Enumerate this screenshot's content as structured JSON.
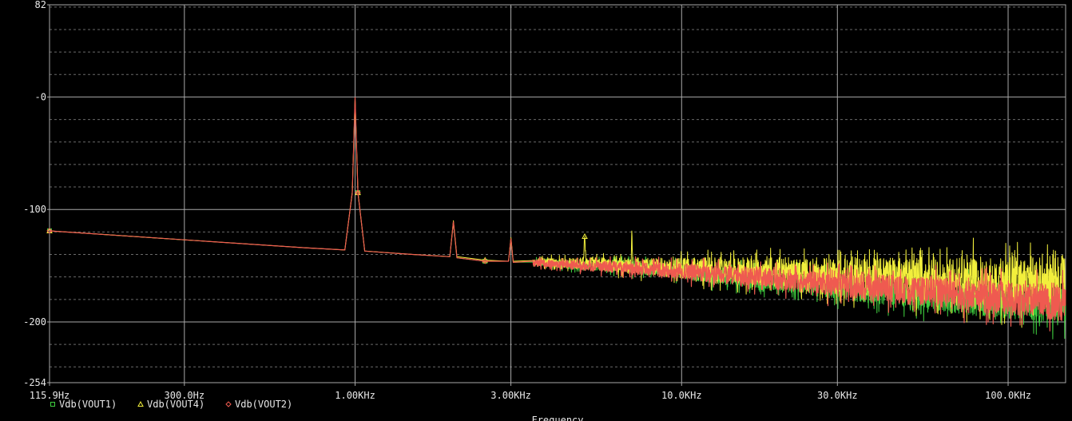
{
  "chart_data": {
    "type": "line",
    "xscale": "log",
    "xlim": [
      115.9,
      150000
    ],
    "ylim": [
      -254,
      82
    ],
    "xlabel": "Frequency",
    "ylabel": "",
    "grid": true,
    "legend_placement": "bottom-left",
    "colors": {
      "background": "#000000",
      "grid_major": "#a8a8a8",
      "grid_minor": "#6a6a6a",
      "text": "#e8e8e8"
    },
    "x_ticks": [
      {
        "value": 115.9,
        "label": "115.9Hz"
      },
      {
        "value": 300,
        "label": "300.0Hz"
      },
      {
        "value": 1000,
        "label": "1.00KHz"
      },
      {
        "value": 3000,
        "label": "3.00KHz"
      },
      {
        "value": 10000,
        "label": "10.0KHz"
      },
      {
        "value": 30000,
        "label": "30.0KHz"
      },
      {
        "value": 100000,
        "label": "100.0KHz"
      }
    ],
    "y_ticks": [
      {
        "value": 82,
        "label": "82"
      },
      {
        "value": 0,
        "label": "-0"
      },
      {
        "value": -100,
        "label": "-100"
      },
      {
        "value": -200,
        "label": "-200"
      },
      {
        "value": -254,
        "label": "-254"
      }
    ],
    "series": [
      {
        "name": "Vdb(VOUT1)",
        "color": "#3fcf3f",
        "marker": "square",
        "points": [
          [
            115.9,
            -119
          ],
          [
            300,
            -127
          ],
          [
            700,
            -134
          ],
          [
            930,
            -136
          ],
          [
            980,
            -85
          ],
          [
            1000,
            -1
          ],
          [
            1020,
            -85
          ],
          [
            1070,
            -137
          ],
          [
            1500,
            -140
          ],
          [
            1950,
            -142
          ],
          [
            2000,
            -112
          ],
          [
            2050,
            -143
          ],
          [
            2500,
            -146
          ],
          [
            2950,
            -146
          ],
          [
            3000,
            -128
          ],
          [
            3050,
            -147
          ],
          [
            4000,
            -148
          ],
          [
            5000,
            -150
          ],
          [
            6000,
            -150
          ],
          [
            7000,
            -151
          ],
          [
            8000,
            -153
          ],
          [
            10000,
            -155
          ],
          [
            12000,
            -158
          ],
          [
            15000,
            -160
          ],
          [
            20000,
            -164
          ],
          [
            25000,
            -166
          ],
          [
            30000,
            -169
          ],
          [
            40000,
            -172
          ],
          [
            50000,
            -175
          ],
          [
            60000,
            -177
          ],
          [
            80000,
            -180
          ],
          [
            100000,
            -182
          ],
          [
            120000,
            -183
          ],
          [
            150000,
            -187
          ]
        ]
      },
      {
        "name": "Vdb(VOUT4)",
        "color": "#f2ef3c",
        "marker": "triangle",
        "points": [
          [
            115.9,
            -119
          ],
          [
            300,
            -127
          ],
          [
            700,
            -134
          ],
          [
            930,
            -136
          ],
          [
            980,
            -85
          ],
          [
            1000,
            -2
          ],
          [
            1020,
            -85
          ],
          [
            1070,
            -137
          ],
          [
            1500,
            -140
          ],
          [
            1950,
            -142
          ],
          [
            2000,
            -110
          ],
          [
            2050,
            -142
          ],
          [
            2500,
            -145
          ],
          [
            2950,
            -146
          ],
          [
            3000,
            -125
          ],
          [
            3050,
            -146
          ],
          [
            4000,
            -147
          ],
          [
            5000,
            -148
          ],
          [
            5050,
            -124
          ],
          [
            5100,
            -148
          ],
          [
            6000,
            -149
          ],
          [
            7000,
            -150
          ],
          [
            7050,
            -120
          ],
          [
            7100,
            -150
          ],
          [
            8000,
            -151
          ],
          [
            10000,
            -152
          ],
          [
            12000,
            -153
          ],
          [
            15000,
            -154
          ],
          [
            20000,
            -156
          ],
          [
            25000,
            -157
          ],
          [
            30000,
            -158
          ],
          [
            40000,
            -160
          ],
          [
            50000,
            -161
          ],
          [
            60000,
            -162
          ],
          [
            80000,
            -163
          ],
          [
            100000,
            -164
          ],
          [
            120000,
            -165
          ],
          [
            150000,
            -166
          ]
        ]
      },
      {
        "name": "Vdb(VOUT2)",
        "color": "#ef5a50",
        "marker": "diamond",
        "points": [
          [
            115.9,
            -119
          ],
          [
            300,
            -127
          ],
          [
            700,
            -134
          ],
          [
            930,
            -136
          ],
          [
            980,
            -85
          ],
          [
            1000,
            -0.5
          ],
          [
            1020,
            -85
          ],
          [
            1070,
            -137
          ],
          [
            1500,
            -140
          ],
          [
            1950,
            -142
          ],
          [
            2000,
            -111
          ],
          [
            2050,
            -143
          ],
          [
            2500,
            -146
          ],
          [
            2950,
            -146
          ],
          [
            3000,
            -126
          ],
          [
            3050,
            -147
          ],
          [
            4000,
            -148
          ],
          [
            5000,
            -150
          ],
          [
            6000,
            -151
          ],
          [
            7000,
            -152
          ],
          [
            8000,
            -153
          ],
          [
            10000,
            -155
          ],
          [
            12000,
            -157
          ],
          [
            15000,
            -159
          ],
          [
            20000,
            -162
          ],
          [
            25000,
            -165
          ],
          [
            30000,
            -167
          ],
          [
            40000,
            -170
          ],
          [
            50000,
            -172
          ],
          [
            60000,
            -174
          ],
          [
            80000,
            -177
          ],
          [
            100000,
            -178
          ],
          [
            120000,
            -180
          ],
          [
            150000,
            -183
          ]
        ]
      }
    ]
  }
}
